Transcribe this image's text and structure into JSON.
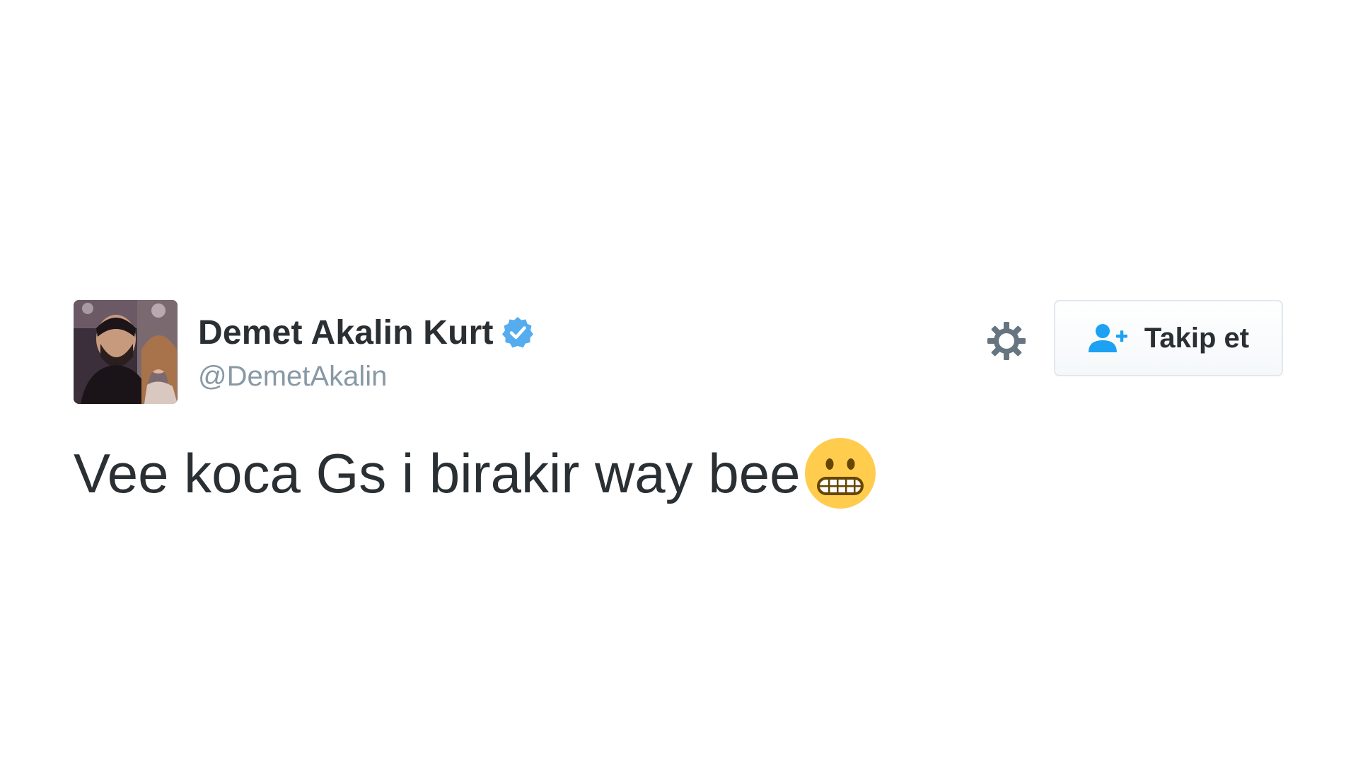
{
  "tweet": {
    "avatar_icon": "profile-photo-avatar",
    "display_name": "Demet Akalin Kurt",
    "verified_icon": "verified-badge-icon",
    "handle": "@DemetAkalin",
    "text": "Vee koca Gs i birakir way bee",
    "emoji_icon": "grimacing-face-emoji"
  },
  "actions": {
    "settings_icon": "gear-icon",
    "follow_icon": "add-user-icon",
    "follow_label": "Takip et"
  },
  "colors": {
    "text_primary": "#292f33",
    "text_secondary": "#8899a6",
    "verified_blue": "#55acee",
    "follow_icon_blue": "#1da1f2",
    "button_border": "#e1e8ed",
    "gear_gray": "#66757f",
    "emoji_yellow": "#ffcc4d"
  }
}
